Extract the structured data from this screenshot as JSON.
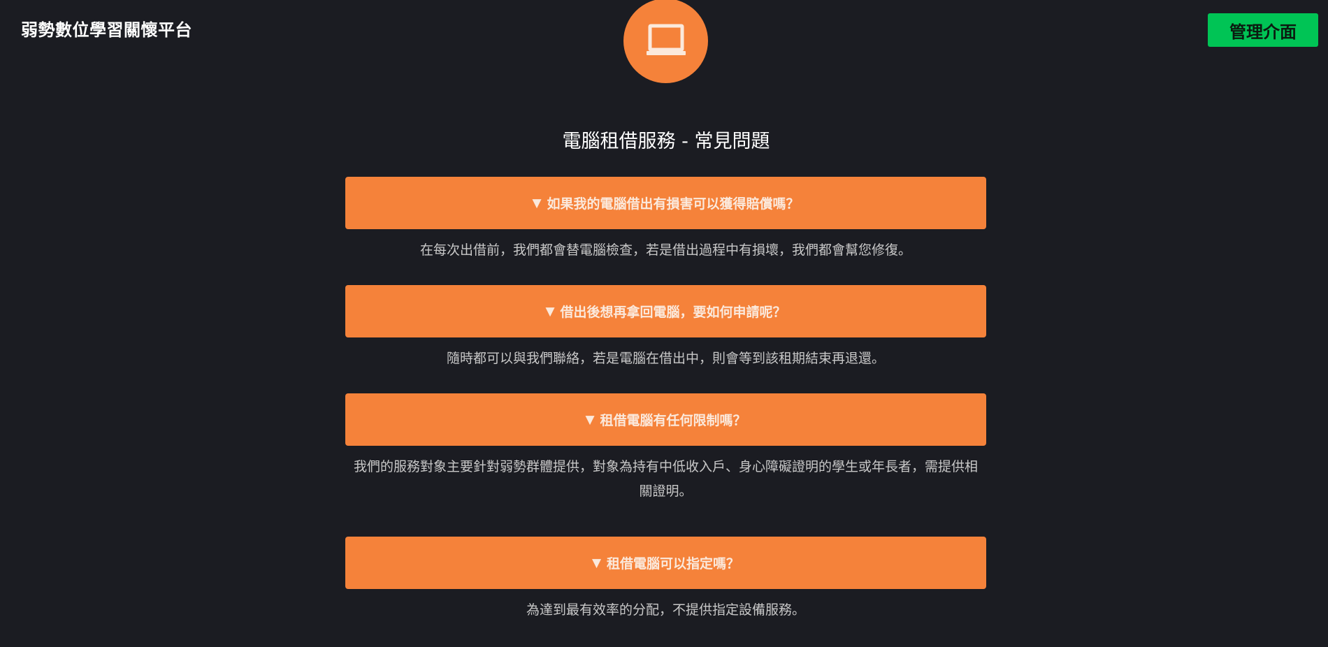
{
  "header": {
    "site_title": "弱勢數位學習關懷平台",
    "admin_label": "管理介面",
    "logo_icon": "laptop-icon"
  },
  "main": {
    "heading": "電腦租借服務 - 常見問題",
    "faqs": [
      {
        "arrow": "▼",
        "question": "如果我的電腦借出有損害可以獲得賠償嗎？",
        "answer": "在每次出借前，我們都會替電腦檢查，若是借出過程中有損壞，我們都會幫您修復。"
      },
      {
        "arrow": "▼",
        "question": "借出後想再拿回電腦，要如何申請呢？",
        "answer": "隨時都可以與我們聯絡，若是電腦在借出中，則會等到該租期結束再退還。"
      },
      {
        "arrow": "▼",
        "question": "租借電腦有任何限制嗎？",
        "answer": "我們的服務對象主要針對弱勢群體提供，對象為持有中低收入戶、身心障礙證明的學生或年長者，需提供相關證明。"
      },
      {
        "arrow": "▼",
        "question": "租借電腦可以指定嗎？",
        "answer": "為達到最有效率的分配，不提供指定設備服務。"
      }
    ]
  },
  "colors": {
    "background": "#1b1c22",
    "accent_orange": "#f5823a",
    "admin_green": "#00c455"
  }
}
